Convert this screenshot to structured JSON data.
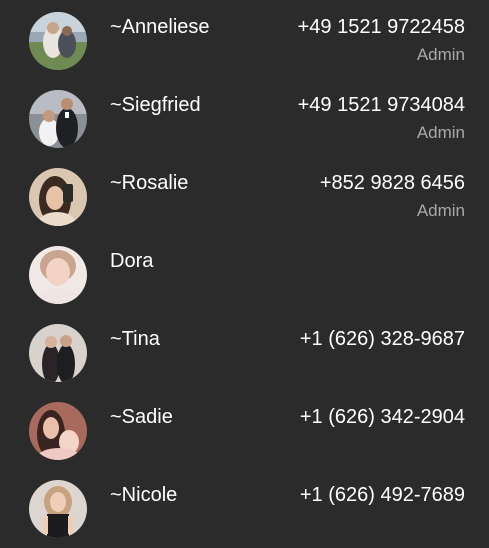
{
  "members": [
    {
      "name": "~Anneliese",
      "phone": "+49 1521 9722458",
      "role": "Admin",
      "avatar": "photo-avatar"
    },
    {
      "name": "~Siegfried",
      "phone": "+49 1521 9734084",
      "role": "Admin",
      "avatar": "photo-avatar"
    },
    {
      "name": "~Rosalie",
      "phone": "+852 9828 6456",
      "role": "Admin",
      "avatar": "photo-avatar"
    },
    {
      "name": "Dora",
      "phone": "",
      "role": "",
      "avatar": "photo-avatar"
    },
    {
      "name": "~Tina",
      "phone": "+1 (626) 328-9687",
      "role": "",
      "avatar": "photo-avatar"
    },
    {
      "name": "~Sadie",
      "phone": "+1 (626) 342-2904",
      "role": "",
      "avatar": "photo-avatar"
    },
    {
      "name": "~Nicole",
      "phone": "+1 (626) 492-7689",
      "role": "",
      "avatar": "photo-avatar"
    }
  ],
  "colors": {
    "background": "#2b2b2b",
    "primary_text": "#ffffff",
    "secondary_text": "#a9a9a9"
  }
}
